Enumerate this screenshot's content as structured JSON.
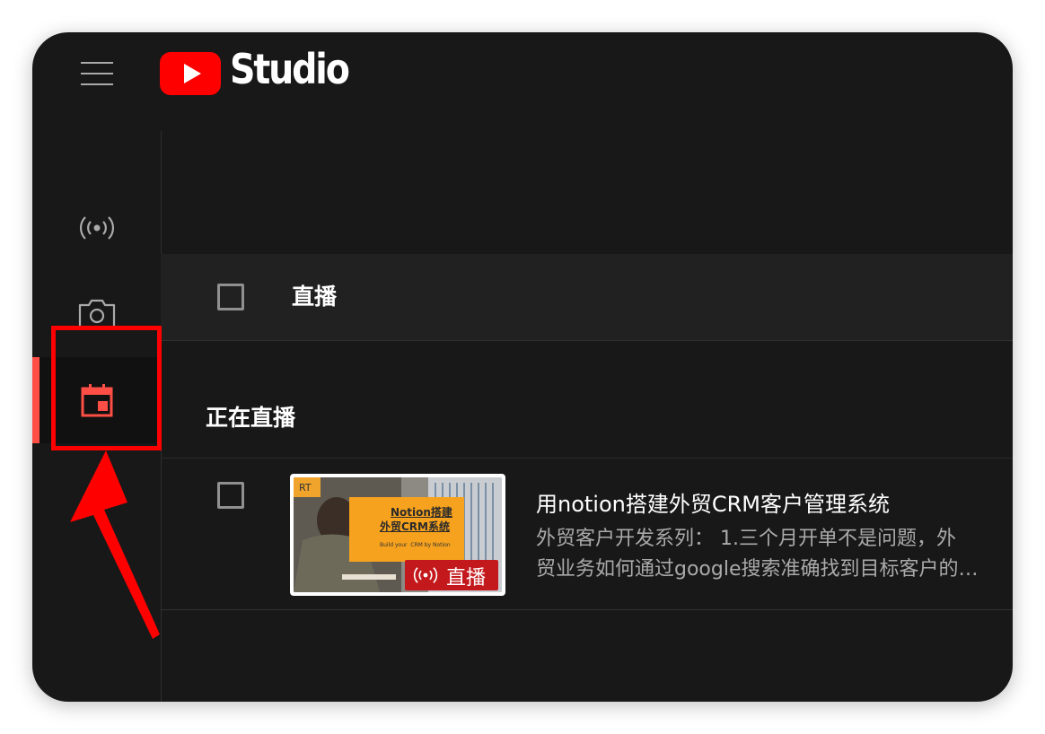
{
  "header": {
    "brand_name": "Studio",
    "menu_icon": "hamburger-menu-icon",
    "logo_icon": "youtube-logo-icon",
    "brand_color": "#ff0000"
  },
  "sidebar": {
    "items": [
      {
        "icon": "live-broadcast-icon",
        "active": false
      },
      {
        "icon": "camera-icon",
        "active": false
      },
      {
        "icon": "calendar-schedule-icon",
        "active": true
      }
    ],
    "active_color": "#ff4e45"
  },
  "list_header": {
    "label": "直播"
  },
  "section": {
    "title": "正在直播"
  },
  "video": {
    "title": "用notion搭建外贸CRM客户管理系统",
    "description_line1": "外贸客户开发系列： 1.三个月开单不是问题，外",
    "description_line2": "贸业务如何通过google搜索准确找到目标客户的…",
    "thumbnail": {
      "corner_tag": "RT",
      "headline_line1": "Notion搭建",
      "headline_line2": "外贸CRM系统",
      "subline": "Build your  CRM by Notion",
      "badge_label": "直播",
      "badge_icon": "live-broadcast-icon"
    }
  },
  "annotation": {
    "highlight_color": "#ff0000"
  }
}
